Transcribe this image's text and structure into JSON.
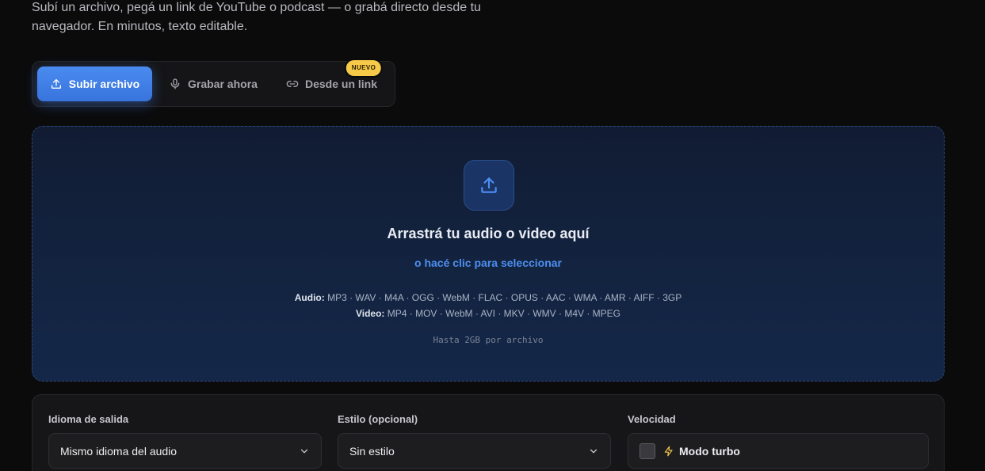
{
  "intro": {
    "text": "Subí un archivo, pegá un link de YouTube o podcast — o grabá directo desde tu navegador. En minutos, texto editable."
  },
  "tabs": [
    {
      "label": "Subir archivo",
      "icon": "upload-icon",
      "active": true
    },
    {
      "label": "Grabar ahora",
      "icon": "microphone-icon",
      "active": false
    },
    {
      "label": "Desde un link",
      "icon": "link-icon",
      "active": false,
      "badge": "NUEVO"
    }
  ],
  "dropzone": {
    "icon": "upload-icon",
    "title": "Arrastrá tu audio o video aquí",
    "link": "o hacé clic para seleccionar",
    "audio_label": "Audio:",
    "audio_formats": "MP3 · WAV · M4A · OGG · WebM · FLAC · OPUS · AAC · WMA · AMR · AIFF · 3GP",
    "video_label": "Video:",
    "video_formats": "MP4 · MOV · WebM · AVI · MKV · WMV · M4V · MPEG",
    "limit": "Hasta 2GB por archivo"
  },
  "settings": {
    "language": {
      "label": "Idioma de salida",
      "value": "Mismo idioma del audio"
    },
    "style": {
      "label": "Estilo (opcional)",
      "value": "Sin estilo"
    },
    "speed": {
      "label": "Velocidad",
      "option": "Modo turbo",
      "checked": false,
      "icon": "lightning-icon"
    }
  },
  "colors": {
    "accent": "#3b7be6",
    "badge": "#f7c948",
    "background": "#0b0b0c",
    "dropzone_border": "#2c4a78"
  }
}
